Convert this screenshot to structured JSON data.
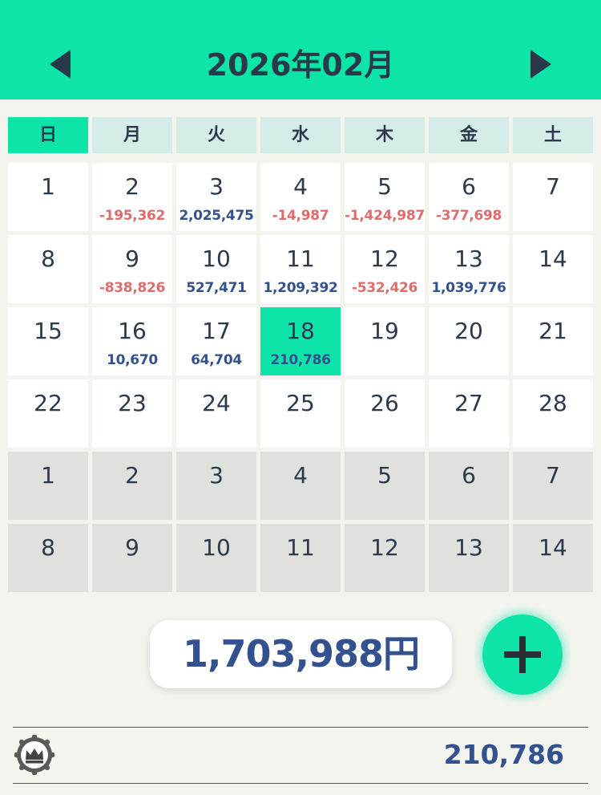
{
  "header": {
    "title": "2026年02月",
    "prev_icon": "triangle-left-icon",
    "next_icon": "triangle-right-icon"
  },
  "weekdays": [
    "日",
    "月",
    "火",
    "水",
    "木",
    "金",
    "土"
  ],
  "calendar": [
    [
      {
        "day": "1",
        "amount": "",
        "sign": "",
        "other": false,
        "today": false
      },
      {
        "day": "2",
        "amount": "-195,362",
        "sign": "neg",
        "other": false,
        "today": false
      },
      {
        "day": "3",
        "amount": "2,025,475",
        "sign": "pos",
        "other": false,
        "today": false
      },
      {
        "day": "4",
        "amount": "-14,987",
        "sign": "neg",
        "other": false,
        "today": false
      },
      {
        "day": "5",
        "amount": "-1,424,987",
        "sign": "neg",
        "other": false,
        "today": false
      },
      {
        "day": "6",
        "amount": "-377,698",
        "sign": "neg",
        "other": false,
        "today": false
      },
      {
        "day": "7",
        "amount": "",
        "sign": "",
        "other": false,
        "today": false
      }
    ],
    [
      {
        "day": "8",
        "amount": "",
        "sign": "",
        "other": false,
        "today": false
      },
      {
        "day": "9",
        "amount": "-838,826",
        "sign": "neg",
        "other": false,
        "today": false
      },
      {
        "day": "10",
        "amount": "527,471",
        "sign": "pos",
        "other": false,
        "today": false
      },
      {
        "day": "11",
        "amount": "1,209,392",
        "sign": "pos",
        "other": false,
        "today": false
      },
      {
        "day": "12",
        "amount": "-532,426",
        "sign": "neg",
        "other": false,
        "today": false
      },
      {
        "day": "13",
        "amount": "1,039,776",
        "sign": "pos",
        "other": false,
        "today": false
      },
      {
        "day": "14",
        "amount": "",
        "sign": "",
        "other": false,
        "today": false
      }
    ],
    [
      {
        "day": "15",
        "amount": "",
        "sign": "",
        "other": false,
        "today": false
      },
      {
        "day": "16",
        "amount": "10,670",
        "sign": "pos",
        "other": false,
        "today": false
      },
      {
        "day": "17",
        "amount": "64,704",
        "sign": "pos",
        "other": false,
        "today": false
      },
      {
        "day": "18",
        "amount": "210,786",
        "sign": "pos",
        "other": false,
        "today": true
      },
      {
        "day": "19",
        "amount": "",
        "sign": "",
        "other": false,
        "today": false
      },
      {
        "day": "20",
        "amount": "",
        "sign": "",
        "other": false,
        "today": false
      },
      {
        "day": "21",
        "amount": "",
        "sign": "",
        "other": false,
        "today": false
      }
    ],
    [
      {
        "day": "22",
        "amount": "",
        "sign": "",
        "other": false,
        "today": false
      },
      {
        "day": "23",
        "amount": "",
        "sign": "",
        "other": false,
        "today": false
      },
      {
        "day": "24",
        "amount": "",
        "sign": "",
        "other": false,
        "today": false
      },
      {
        "day": "25",
        "amount": "",
        "sign": "",
        "other": false,
        "today": false
      },
      {
        "day": "26",
        "amount": "",
        "sign": "",
        "other": false,
        "today": false
      },
      {
        "day": "27",
        "amount": "",
        "sign": "",
        "other": false,
        "today": false
      },
      {
        "day": "28",
        "amount": "",
        "sign": "",
        "other": false,
        "today": false
      }
    ],
    [
      {
        "day": "1",
        "amount": "",
        "sign": "",
        "other": true,
        "today": false
      },
      {
        "day": "2",
        "amount": "",
        "sign": "",
        "other": true,
        "today": false
      },
      {
        "day": "3",
        "amount": "",
        "sign": "",
        "other": true,
        "today": false
      },
      {
        "day": "4",
        "amount": "",
        "sign": "",
        "other": true,
        "today": false
      },
      {
        "day": "5",
        "amount": "",
        "sign": "",
        "other": true,
        "today": false
      },
      {
        "day": "6",
        "amount": "",
        "sign": "",
        "other": true,
        "today": false
      },
      {
        "day": "7",
        "amount": "",
        "sign": "",
        "other": true,
        "today": false
      }
    ],
    [
      {
        "day": "8",
        "amount": "",
        "sign": "",
        "other": true,
        "today": false
      },
      {
        "day": "9",
        "amount": "",
        "sign": "",
        "other": true,
        "today": false
      },
      {
        "day": "10",
        "amount": "",
        "sign": "",
        "other": true,
        "today": false
      },
      {
        "day": "11",
        "amount": "",
        "sign": "",
        "other": true,
        "today": false
      },
      {
        "day": "12",
        "amount": "",
        "sign": "",
        "other": true,
        "today": false
      },
      {
        "day": "13",
        "amount": "",
        "sign": "",
        "other": true,
        "today": false
      },
      {
        "day": "14",
        "amount": "",
        "sign": "",
        "other": true,
        "today": false
      }
    ]
  ],
  "summary": {
    "total": "1,703,988円",
    "add_icon": "plus-icon"
  },
  "footer": {
    "badge_icon": "crown-badge-icon",
    "amount": "210,786"
  },
  "colors": {
    "accent": "#0ee3a8",
    "positive": "#33508f",
    "negative": "#e06b6b"
  }
}
